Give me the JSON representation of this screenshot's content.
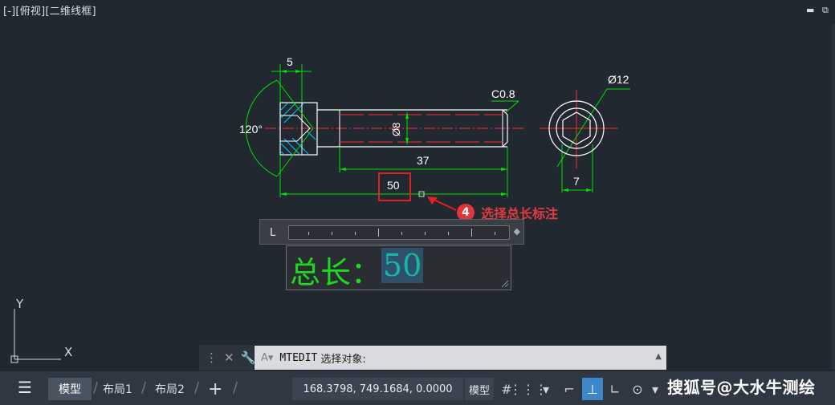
{
  "viewport": {
    "label": "[-][俯视][二维线框]",
    "controls": {
      "minimize": "▬",
      "restore": "⧉"
    }
  },
  "drawing": {
    "dims": {
      "head_width": "5",
      "angle": "120°",
      "chamfer": "C0.8",
      "shank_diameter": "Ø8",
      "thread_length": "37",
      "total_length": "50",
      "circle_diameter": "Ø12",
      "hex_width": "7"
    },
    "colors": {
      "outline": "#ffffff",
      "dimension": "#00e000",
      "center": "#ff2a2a",
      "hatch": "#00c8ff",
      "highlight": "#e02020"
    }
  },
  "ucs": {
    "x": "X",
    "y": "Y"
  },
  "annotation": {
    "step": "4",
    "text": "选择总长标注"
  },
  "ruler": {
    "tab_marker": "L",
    "handle": "◆"
  },
  "mtext": {
    "label": "总长：",
    "value": "50"
  },
  "command": {
    "close": "✕",
    "wrench": "🔧",
    "prompt_icon": "A▾",
    "cmd": "MTEDIT",
    "prompt": "选择对象:",
    "expand": "▲"
  },
  "status": {
    "menu_icon": "☰",
    "tabs": [
      {
        "label": "模型"
      },
      {
        "label": "布局1"
      },
      {
        "label": "布局2"
      }
    ],
    "add": "+",
    "coords": "168.3798, 749.1684, 0.0000",
    "model_btn": "模型",
    "icons": {
      "grid": "#",
      "snap": "⋮⋮⋮",
      "dropdown": "▾",
      "ortho": "⌐",
      "osnap_on": "⊥",
      "polar": "∟",
      "track": "⊙",
      "more": "▾"
    }
  },
  "watermark": "搜狐号@大水牛测绘"
}
